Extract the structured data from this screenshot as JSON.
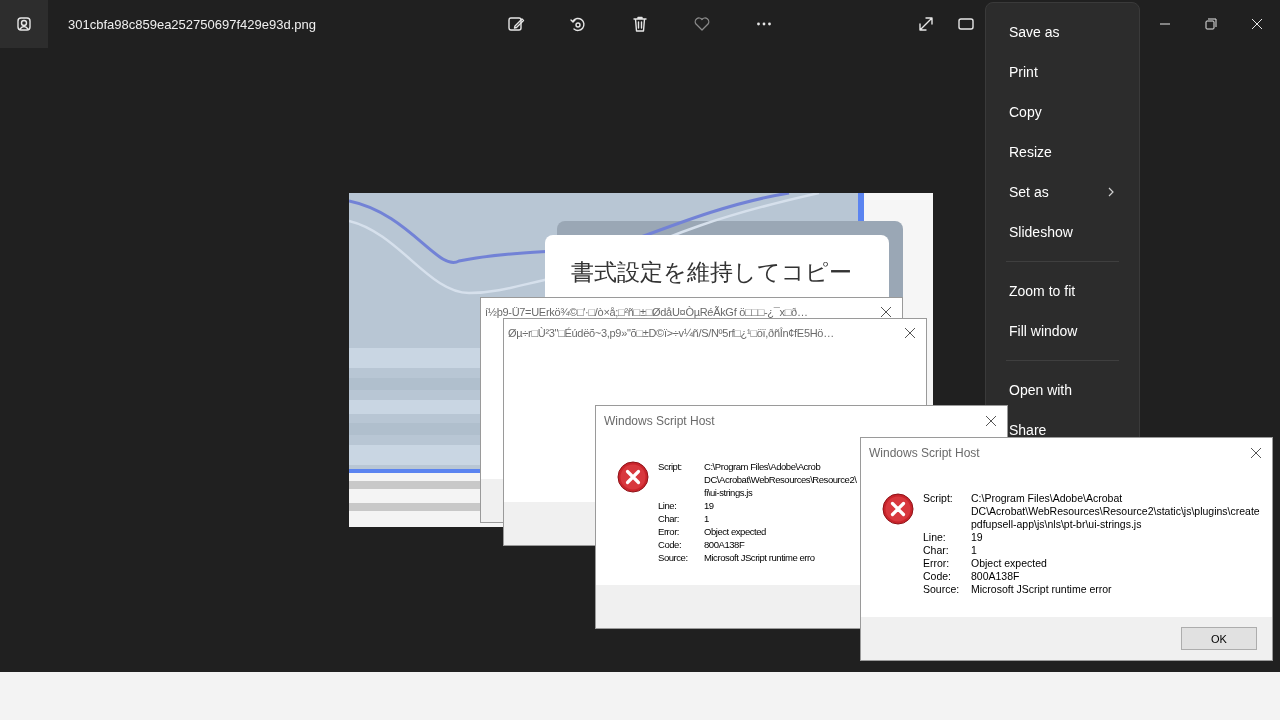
{
  "window": {
    "title": "301cbfa98c859ea252750697f429e93d.png"
  },
  "image": {
    "heading": "書式設定を維持してコピー"
  },
  "context_menu": {
    "items": [
      {
        "kind": "item",
        "label": "Save as",
        "has_submenu": false
      },
      {
        "kind": "item",
        "label": "Print",
        "has_submenu": false
      },
      {
        "kind": "item",
        "label": "Copy",
        "has_submenu": false
      },
      {
        "kind": "item",
        "label": "Resize",
        "has_submenu": false
      },
      {
        "kind": "item",
        "label": "Set as",
        "has_submenu": true
      },
      {
        "kind": "item",
        "label": "Slideshow",
        "has_submenu": false
      },
      {
        "kind": "separator"
      },
      {
        "kind": "item",
        "label": "Zoom to fit",
        "has_submenu": false
      },
      {
        "kind": "item",
        "label": "Fill window",
        "has_submenu": false
      },
      {
        "kind": "separator"
      },
      {
        "kind": "item",
        "label": "Open with",
        "has_submenu": false
      },
      {
        "kind": "item",
        "label": "Share",
        "has_submenu": false
      }
    ]
  },
  "dialogs": [
    {
      "kind": "blank",
      "title": "í½þ9-Ü7=UErkö¾©□'·□/ò×å;□²ñ□±□ØdåU¤ÒµRéÃkGf ö□□□-¿¯x□ð…"
    },
    {
      "kind": "blank",
      "title": "Øµ÷r□Ù²3\"□Éúdëõ~3,p9»\"õ□±D©ï>÷v¼ñ/S/Nº5rf□¿¹□öï,ðñÎn¢fE5Hö…"
    },
    {
      "kind": "error",
      "title": "Windows Script Host",
      "fields": [
        {
          "label": "Script:",
          "value": "C:\\Program Files\\Adobe\\Acrob\nDC\\Acrobat\\WebResources\\Resource2\\\nfi\\ui-strings.js"
        },
        {
          "label": "Line:",
          "value": "19"
        },
        {
          "label": "Char:",
          "value": "1"
        },
        {
          "label": "Error:",
          "value": "Object expected"
        },
        {
          "label": "Code:",
          "value": "800A138F"
        },
        {
          "label": "Source:",
          "value": "Microsoft JScript runtime erro"
        }
      ]
    },
    {
      "kind": "error",
      "title": "Windows Script Host",
      "fields": [
        {
          "label": "Script:",
          "value": "C:\\Program Files\\Adobe\\Acrobat\nDC\\Acrobat\\WebResources\\Resource2\\static\\js\\plugins\\create\npdfupsell-app\\js\\nls\\pt-br\\ui-strings.js"
        },
        {
          "label": "Line:",
          "value": "19"
        },
        {
          "label": "Char:",
          "value": "1"
        },
        {
          "label": "Error:",
          "value": "Object expected"
        },
        {
          "label": "Code:",
          "value": "800A138F"
        },
        {
          "label": "Source:",
          "value": "Microsoft JScript runtime error"
        }
      ],
      "buttons": [
        "OK"
      ]
    }
  ]
}
